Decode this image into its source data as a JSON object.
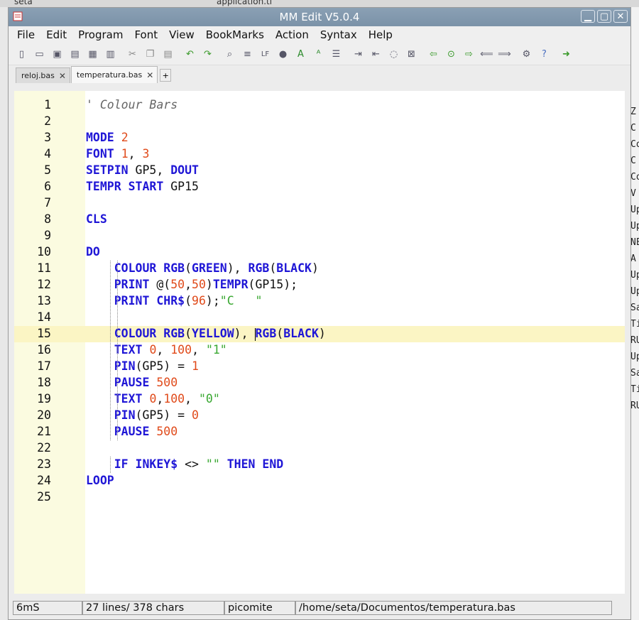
{
  "window": {
    "title": "MM Edit V5.0.4"
  },
  "background": {
    "top_left_text": "seta",
    "top_mid_text": "application.tl",
    "right_chars": [
      "Z",
      "C",
      "Co",
      "C",
      "Co",
      "V",
      "Up",
      "Up",
      "NE",
      "A",
      "Up",
      "Up",
      "Sa",
      "Ti",
      "RU",
      "Up",
      "Sa",
      "Ti",
      "RU"
    ]
  },
  "menu": [
    "File",
    "Edit",
    "Program",
    "Font",
    "View",
    "BookMarks",
    "Action",
    "Syntax",
    "Help"
  ],
  "toolbar": [
    {
      "icon": "new-file-icon",
      "glyph": "▯"
    },
    {
      "icon": "open-file-icon",
      "glyph": "▭"
    },
    {
      "icon": "save-icon",
      "glyph": "▣"
    },
    {
      "icon": "save-all-icon",
      "glyph": "▤"
    },
    {
      "icon": "screenshot-icon",
      "glyph": "▦"
    },
    {
      "icon": "print-icon",
      "glyph": "▥"
    },
    {
      "sep": true
    },
    {
      "icon": "cut-icon",
      "glyph": "✂"
    },
    {
      "icon": "copy-icon",
      "glyph": "❐"
    },
    {
      "icon": "paste-icon",
      "glyph": "▤"
    },
    {
      "sep": true
    },
    {
      "icon": "undo-icon",
      "glyph": "↶"
    },
    {
      "icon": "redo-icon",
      "glyph": "↷"
    },
    {
      "sep": true
    },
    {
      "icon": "find-icon",
      "glyph": "⌕"
    },
    {
      "icon": "list-icon",
      "glyph": "≡"
    },
    {
      "icon": "lf-icon",
      "glyph": "LF"
    },
    {
      "icon": "dot-icon",
      "glyph": "●"
    },
    {
      "icon": "font-icon",
      "glyph": "A"
    },
    {
      "icon": "replace-icon",
      "glyph": "ᴬ"
    },
    {
      "icon": "numbered-list-icon",
      "glyph": "☰"
    },
    {
      "sep": true
    },
    {
      "icon": "indent-icon",
      "glyph": "⇥"
    },
    {
      "icon": "outdent-icon",
      "glyph": "⇤"
    },
    {
      "icon": "comment-icon",
      "glyph": "◌"
    },
    {
      "icon": "uncomment-icon",
      "glyph": "⊠"
    },
    {
      "sep": true
    },
    {
      "icon": "back-icon",
      "glyph": "⇦"
    },
    {
      "icon": "run-icon",
      "glyph": "⊙"
    },
    {
      "icon": "forward-icon",
      "glyph": "⇨"
    },
    {
      "icon": "prev-icon",
      "glyph": "⟸"
    },
    {
      "icon": "next-icon",
      "glyph": "⟹"
    },
    {
      "sep": true
    },
    {
      "icon": "settings-icon",
      "glyph": "⚙"
    },
    {
      "icon": "help-icon",
      "glyph": "?"
    },
    {
      "sep": true
    },
    {
      "icon": "upload-icon",
      "glyph": "➜"
    }
  ],
  "tabs": [
    {
      "label": "reloj.bas",
      "active": false
    },
    {
      "label": "temperatura.bas",
      "active": true
    }
  ],
  "tab_add": "+",
  "colors": {
    "keyword": "#1f16d6",
    "number": "#e04a1a",
    "string": "#3aa832",
    "comment": "#666666",
    "gutter": "#fbfbe0",
    "current_line": "#fbf5c4"
  },
  "code_lines": [
    [
      {
        "t": "cmt",
        "v": "' Colour Bars"
      }
    ],
    [],
    [
      {
        "t": "kw",
        "v": "MODE"
      },
      {
        "t": "",
        "v": " "
      },
      {
        "t": "num",
        "v": "2"
      }
    ],
    [
      {
        "t": "kw",
        "v": "FONT"
      },
      {
        "t": "",
        "v": " "
      },
      {
        "t": "num",
        "v": "1"
      },
      {
        "t": "",
        "v": ", "
      },
      {
        "t": "num",
        "v": "3"
      }
    ],
    [
      {
        "t": "kw",
        "v": "SETPIN"
      },
      {
        "t": "",
        "v": " GP5, "
      },
      {
        "t": "kw",
        "v": "DOUT"
      }
    ],
    [
      {
        "t": "kw",
        "v": "TEMPR START"
      },
      {
        "t": "",
        "v": " GP15"
      }
    ],
    [],
    [
      {
        "t": "kw",
        "v": "CLS"
      }
    ],
    [],
    [
      {
        "t": "kw",
        "v": "DO"
      }
    ],
    [
      {
        "t": "",
        "v": "    "
      },
      {
        "t": "kw",
        "v": "COLOUR RGB"
      },
      {
        "t": "",
        "v": "("
      },
      {
        "t": "kw",
        "v": "GREEN"
      },
      {
        "t": "",
        "v": "), "
      },
      {
        "t": "kw",
        "v": "RGB"
      },
      {
        "t": "",
        "v": "("
      },
      {
        "t": "kw",
        "v": "BLACK"
      },
      {
        "t": "",
        "v": ")"
      }
    ],
    [
      {
        "t": "",
        "v": "    "
      },
      {
        "t": "kw",
        "v": "PRINT"
      },
      {
        "t": "",
        "v": " @("
      },
      {
        "t": "num",
        "v": "50"
      },
      {
        "t": "",
        "v": ","
      },
      {
        "t": "num",
        "v": "50"
      },
      {
        "t": "",
        "v": ")"
      },
      {
        "t": "kw",
        "v": "TEMPR"
      },
      {
        "t": "",
        "v": "(GP15);"
      }
    ],
    [
      {
        "t": "",
        "v": "    "
      },
      {
        "t": "kw",
        "v": "PRINT CHR$"
      },
      {
        "t": "",
        "v": "("
      },
      {
        "t": "num",
        "v": "96"
      },
      {
        "t": "",
        "v": ");"
      },
      {
        "t": "str",
        "v": "\"C   \""
      }
    ],
    [],
    [
      {
        "t": "",
        "v": "    "
      },
      {
        "t": "kw",
        "v": "COLOUR RGB"
      },
      {
        "t": "",
        "v": "("
      },
      {
        "t": "kw",
        "v": "YELLOW"
      },
      {
        "t": "",
        "v": "), "
      },
      {
        "t": "kw",
        "v": "RGB"
      },
      {
        "t": "",
        "v": "("
      },
      {
        "t": "kw",
        "v": "BLACK"
      },
      {
        "t": "",
        "v": ")"
      }
    ],
    [
      {
        "t": "",
        "v": "    "
      },
      {
        "t": "kw",
        "v": "TEXT"
      },
      {
        "t": "",
        "v": " "
      },
      {
        "t": "num",
        "v": "0"
      },
      {
        "t": "",
        "v": ", "
      },
      {
        "t": "num",
        "v": "100"
      },
      {
        "t": "",
        "v": ", "
      },
      {
        "t": "str",
        "v": "\"1\""
      }
    ],
    [
      {
        "t": "",
        "v": "    "
      },
      {
        "t": "kw",
        "v": "PIN"
      },
      {
        "t": "",
        "v": "(GP5) = "
      },
      {
        "t": "num",
        "v": "1"
      }
    ],
    [
      {
        "t": "",
        "v": "    "
      },
      {
        "t": "kw",
        "v": "PAUSE"
      },
      {
        "t": "",
        "v": " "
      },
      {
        "t": "num",
        "v": "500"
      }
    ],
    [
      {
        "t": "",
        "v": "    "
      },
      {
        "t": "kw",
        "v": "TEXT"
      },
      {
        "t": "",
        "v": " "
      },
      {
        "t": "num",
        "v": "0"
      },
      {
        "t": "",
        "v": ","
      },
      {
        "t": "num",
        "v": "100"
      },
      {
        "t": "",
        "v": ", "
      },
      {
        "t": "str",
        "v": "\"0\""
      }
    ],
    [
      {
        "t": "",
        "v": "    "
      },
      {
        "t": "kw",
        "v": "PIN"
      },
      {
        "t": "",
        "v": "(GP5) = "
      },
      {
        "t": "num",
        "v": "0"
      }
    ],
    [
      {
        "t": "",
        "v": "    "
      },
      {
        "t": "kw",
        "v": "PAUSE"
      },
      {
        "t": "",
        "v": " "
      },
      {
        "t": "num",
        "v": "500"
      }
    ],
    [],
    [
      {
        "t": "",
        "v": "    "
      },
      {
        "t": "kw",
        "v": "IF INKEY$"
      },
      {
        "t": "",
        "v": " <> "
      },
      {
        "t": "str",
        "v": "\"\""
      },
      {
        "t": "",
        "v": " "
      },
      {
        "t": "kw",
        "v": "THEN END"
      }
    ],
    [
      {
        "t": "kw",
        "v": "LOOP"
      }
    ],
    []
  ],
  "current_line": 15,
  "status": {
    "time": "6mS",
    "counts": "27 lines/ 378 chars",
    "device": "picomite",
    "path": "/home/seta/Documentos/temperatura.bas"
  }
}
